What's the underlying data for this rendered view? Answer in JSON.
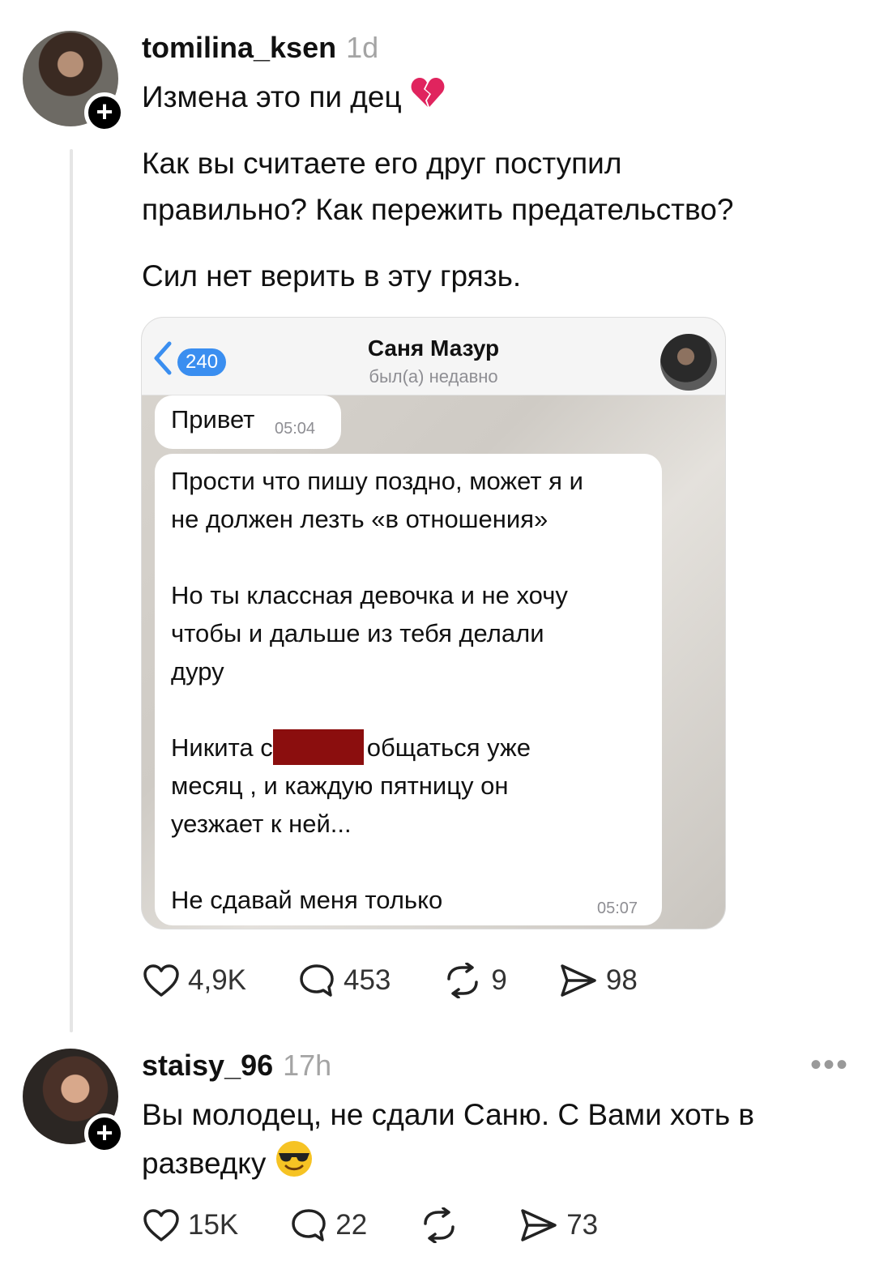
{
  "post1": {
    "username": "tomilina_ksen",
    "time": "1d",
    "title": "Измена это пи  дец",
    "body_line1": "Как вы считаете его друг поступил",
    "body_line2": "правильно? Как пережить предательство?",
    "body_line3": "Сил нет верить в эту грязь.",
    "icons": [
      "avatar",
      "plus-icon",
      "broken-heart-emoji"
    ],
    "actions": {
      "likes": "4,9K",
      "comments": "453",
      "reposts": "9",
      "shares": "98"
    }
  },
  "screenshot": {
    "back_count": "240",
    "contact_name": "Саня Мазур",
    "contact_status": "был(а) недавно",
    "msg1": {
      "text": "Привет",
      "time": "05:04"
    },
    "msg2": {
      "line1": "Прости что пишу поздно, может я и",
      "line2": "не должен лезть «в отношения»",
      "line3": "Но ты классная девочка и не хочу",
      "line4": "чтобы и дальше из тебя делали",
      "line5": "дуру",
      "line6_pre": "Никита с",
      "line6_post": "общаться уже",
      "line7": "месяц , и каждую пятницу он",
      "line8": "уезжает к ней...",
      "line9": "Не сдавай меня только",
      "time": "05:07"
    }
  },
  "post2": {
    "username": "staisy_96",
    "time": "17h",
    "more": "•••",
    "line1": "Вы молодец, не сдали Саню. С Вами хоть в",
    "line2": "разведку",
    "icons": [
      "avatar",
      "plus-icon",
      "sunglasses-emoji",
      "more-icon"
    ],
    "actions": {
      "likes": "15K",
      "comments": "22",
      "reposts": "",
      "shares": "73"
    }
  },
  "colors": {
    "accent": "#3a8ef0",
    "redaction": "#8b0e0e",
    "muted": "#a4a4a4",
    "broken_heart": "#e0245e"
  }
}
